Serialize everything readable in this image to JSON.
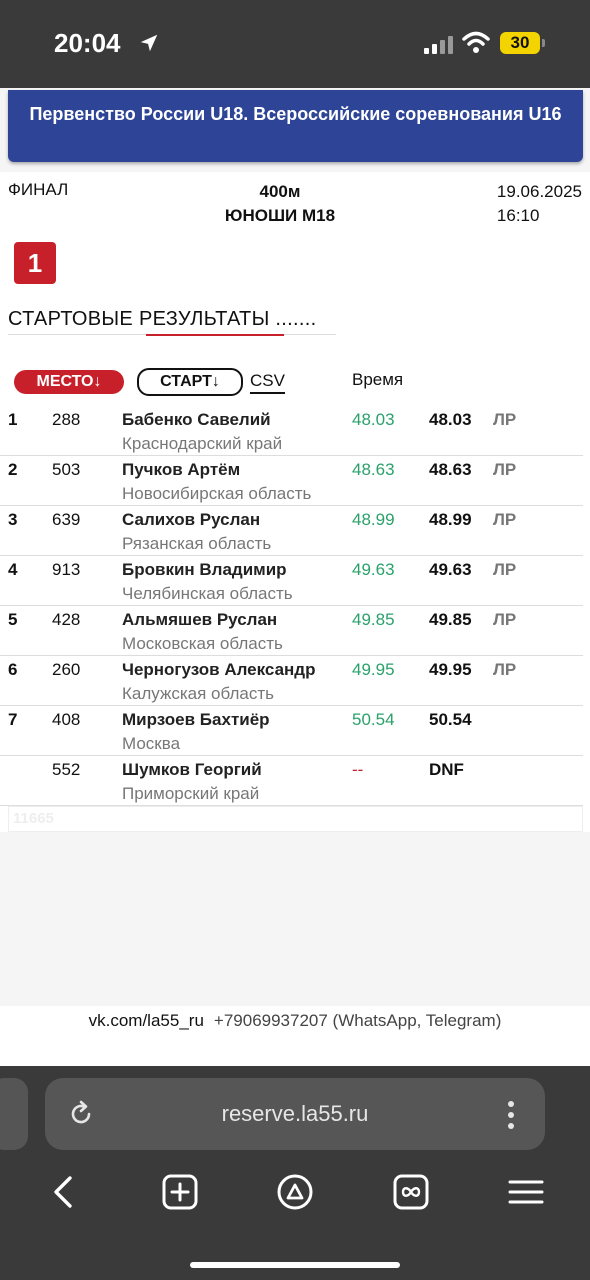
{
  "status_bar": {
    "time": "20:04",
    "battery": "30"
  },
  "banner": {
    "title": "Первенство России U18. Всероссийские соревнования U16"
  },
  "event": {
    "stage": "ФИНАЛ",
    "distance": "400м",
    "category": "ЮНОШИ М18",
    "date": "19.06.2025",
    "time": "16:10",
    "heat": "1"
  },
  "section": {
    "title_part1": "СТАРТОВЫЕ ",
    "title_part2": "РЕЗУЛЬТАТЫ",
    "title_part3": " ......."
  },
  "controls": {
    "place_label": "МЕСТО↓",
    "start_label": "СТАРТ↓",
    "csv_label": "CSV",
    "time_header": "Время"
  },
  "results": [
    {
      "place": "1",
      "bib": "288",
      "name": "Бабенко Савелий",
      "region": "Краснодарский край",
      "time": "48.03",
      "final": "48.03",
      "tag": "ЛР"
    },
    {
      "place": "2",
      "bib": "503",
      "name": "Пучков Артём",
      "region": "Новосибирская область",
      "time": "48.63",
      "final": "48.63",
      "tag": "ЛР"
    },
    {
      "place": "3",
      "bib": "639",
      "name": "Салихов Руслан",
      "region": "Рязанская область",
      "time": "48.99",
      "final": "48.99",
      "tag": "ЛР"
    },
    {
      "place": "4",
      "bib": "913",
      "name": "Бровкин Владимир",
      "region": "Челябинская область",
      "time": "49.63",
      "final": "49.63",
      "tag": "ЛР"
    },
    {
      "place": "5",
      "bib": "428",
      "name": "Альмяшев Руслан",
      "region": "Московская область",
      "time": "49.85",
      "final": "49.85",
      "tag": "ЛР"
    },
    {
      "place": "6",
      "bib": "260",
      "name": "Черногузов Александр",
      "region": "Калужская область",
      "time": "49.95",
      "final": "49.95",
      "tag": "ЛР"
    },
    {
      "place": "7",
      "bib": "408",
      "name": "Мирзоев Бахтиёр",
      "region": "Москва",
      "time": "50.54",
      "final": "50.54",
      "tag": ""
    },
    {
      "place": "",
      "bib": "552",
      "name": "Шумков Георгий",
      "region": "Приморский край",
      "time": "--",
      "final": "DNF",
      "tag": ""
    }
  ],
  "footer_code": "11665",
  "contact": {
    "vk": "vk.com/la55_ru",
    "phone": "+79069937207 (WhatsApp, Telegram)"
  },
  "browser": {
    "url": "reserve.la55.ru"
  },
  "colors": {
    "banner": "#2e4597",
    "accent_red": "#c8202a",
    "time_green": "#2aa16b"
  }
}
